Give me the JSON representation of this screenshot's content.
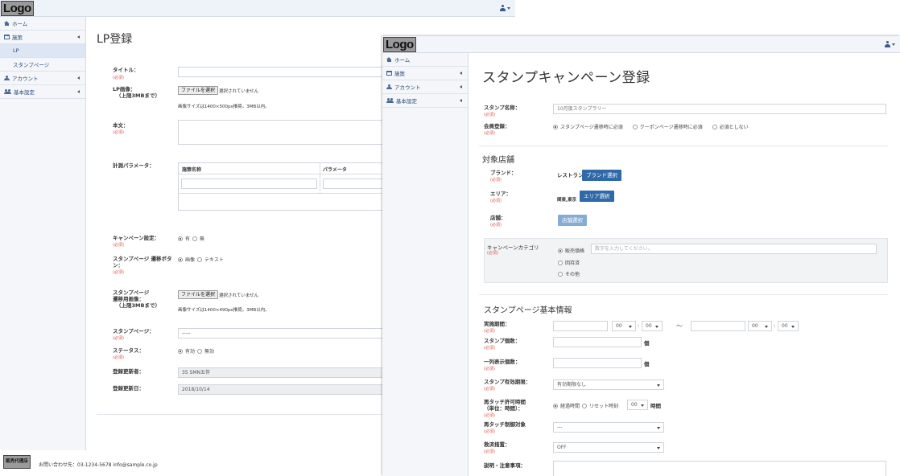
{
  "lp_window": {
    "logo": "Logo",
    "sidebar": [
      {
        "label": "ホーム"
      },
      {
        "label": "施策"
      },
      {
        "label": "LP"
      },
      {
        "label": "スタンプページ"
      },
      {
        "label": "アカウント"
      },
      {
        "label": "基本設定"
      }
    ],
    "page_title": "LP登録",
    "required": "(必須)",
    "form": {
      "title_label": "タイトル：",
      "image_label": "LP画像：",
      "image_label_sub": "（上限3MBまで）",
      "file_button": "ファイルを選択",
      "no_file": "選択されていません",
      "image_hint": "画像サイズは1400×500px推奨。3MB以内。",
      "body_label": "本文：",
      "params_label": "計測パラメータ：",
      "params_col1": "施策名称",
      "params_col2": "パラメータ",
      "campaign_label": "キャンペーン設定：",
      "campaign_options": [
        "有",
        "無"
      ],
      "stamp_btn_label1": "スタンプページ 遷移ボタ",
      "stamp_btn_label2": "ン：",
      "stamp_btn_options": [
        "画像",
        "テキスト"
      ],
      "stamp_img_label1": "スタンプページ",
      "stamp_img_label2": "遷移用画像：",
      "stamp_img_label3": "（上限3MBまで）",
      "stamp_img_hint": "画像サイズは1400×490px推奨。3MB以内。",
      "stamp_page_label": "スタンプページ：",
      "stamp_page_value": "-----",
      "status_label": "ステータス：",
      "status_options": [
        "有効",
        "無効"
      ],
      "updater_label": "登録更新者：",
      "updater_value": "35 SMN五伴",
      "updated_label": "登録更新日：",
      "updated_value": "2018/10/14"
    },
    "footer": {
      "logo": "販売代理店",
      "contact": "お問い合わせ先：03-1234-5678 info@sample.co.jp"
    }
  },
  "stamp_window": {
    "logo": "Logo",
    "sidebar": [
      {
        "label": "ホーム"
      },
      {
        "label": "施策"
      },
      {
        "label": "アカウント"
      },
      {
        "label": "基本設定"
      }
    ],
    "page_title": "スタンプキャンペーン登録",
    "required": "(必須)",
    "stamp_name_label": "スタンプ名称：",
    "stamp_name_value": "10月度スタンプラリー",
    "member_label": "会員登録：",
    "member_options": [
      "スタンプページ遷移時に必須",
      "クーポンページ遷移時に必須",
      "必須としない"
    ],
    "target_section": "対象店舗",
    "brand_label": "ブランド：",
    "brand_value": "レストラン",
    "brand_button": "ブランド選択",
    "area_label": "エリア：",
    "area_value": "関東,東京",
    "area_button": "エリア選択",
    "store_label": "店舗：",
    "store_button": "店舗選択",
    "category_label": "キャンペーンカテゴリ",
    "category_options": [
      "販売価格",
      "回持済",
      "その他"
    ],
    "category_placeholder": "数字を入力してください。",
    "basic_section": "スタンプページ基本情報",
    "period_label": "実施期間：",
    "time_hour": "00",
    "time_min": "00",
    "colon": ":",
    "tilde": "～",
    "stamp_count_label": "スタンプ個数：",
    "unit": "個",
    "row_count_label": "一列表示個数：",
    "expiry_label": "スタンプ有効期限：",
    "expiry_value": "有効期限なし",
    "retouch_label1": "再タッチ許可時間",
    "retouch_label2": "（単位：時間）：",
    "retouch_options": [
      "経過時間",
      "リセット時刻"
    ],
    "retouch_hour": "00",
    "retouch_unit": "時間",
    "retouch_target_label": "再タッチ制御対象",
    "retouch_target_value": "---",
    "rescue_label": "救済措置：",
    "rescue_value": "OFF",
    "notes_label": "説明・注意事項："
  }
}
